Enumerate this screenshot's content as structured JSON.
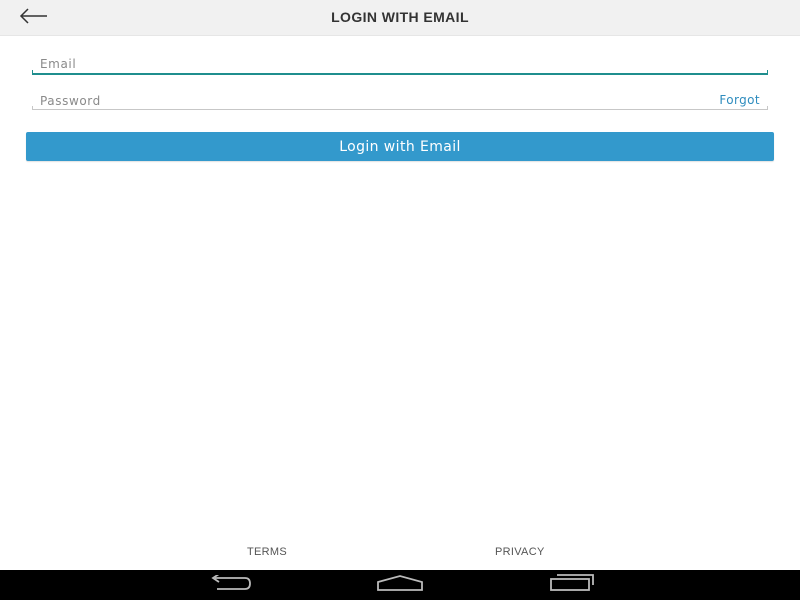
{
  "header": {
    "title": "LOGIN WITH EMAIL",
    "back_icon": "arrow-left-icon"
  },
  "form": {
    "email": {
      "value": "",
      "placeholder": "Email"
    },
    "password": {
      "value": "",
      "placeholder": "Password"
    },
    "forgot_label": "Forgot",
    "submit_label": "Login with Email"
  },
  "footer": {
    "terms_label": "TERMS",
    "privacy_label": "PRIVACY"
  },
  "system_nav": {
    "back_icon": "nav-back-icon",
    "home_icon": "nav-home-icon",
    "recents_icon": "nav-recents-icon"
  },
  "colors": {
    "accent": "#3399cc",
    "link": "#2e8cbe",
    "focus_underline": "#1f8e8e",
    "app_bar": "#f1f1f1"
  }
}
